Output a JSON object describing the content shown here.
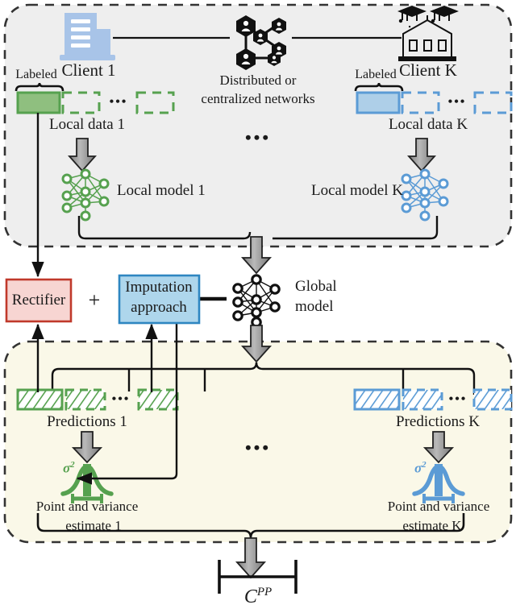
{
  "diagram": {
    "title_symbol": "C",
    "colors": {
      "client_zone_fill": "#eeeeee",
      "estimate_zone_fill": "#faf8e8",
      "green": "#56a14f",
      "green_fill": "#8fbf7f",
      "blue": "#5b9bd5",
      "blue_fill": "#aecfe8",
      "rect_red_border": "#c0392b",
      "rect_red_fill": "#f7d5d2",
      "imput_blue_border": "#2e86c1",
      "imput_blue_fill": "#aed6ec",
      "arrow_grey": "#9d9d9d",
      "line_black": "#111111"
    }
  },
  "client_zone": {
    "client1": {
      "label": "Client 1",
      "icon": "office-building-icon"
    },
    "clientK": {
      "label": "Client K",
      "icon": "university-building-icon"
    },
    "network": {
      "icon": "distributed-network-icon",
      "label_line1": "Distributed or",
      "label_line2": "centralized networks"
    },
    "ellipsis_center": "•••",
    "data1": {
      "labeled_tag": "Labeled",
      "label": "Local data 1",
      "ellipsis": "•••"
    },
    "dataK": {
      "labeled_tag": "Labeled",
      "label": "Local data K",
      "ellipsis": "•••"
    },
    "model1": {
      "label": "Local model 1",
      "icon": "neural-network-icon"
    },
    "modelK": {
      "label": "Local model K",
      "icon": "neural-network-icon"
    }
  },
  "middle": {
    "rectifier": {
      "label": "Rectifier"
    },
    "plus": "+",
    "imputation": {
      "line1": "Imputation",
      "line2": "approach"
    },
    "global_model": {
      "line1": "Global",
      "line2": "model",
      "icon": "neural-network-icon"
    }
  },
  "estimate_zone": {
    "predictions1": {
      "label": "Predictions 1",
      "ellipsis": "•••"
    },
    "predictionsK": {
      "label": "Predictions K",
      "ellipsis": "•••"
    },
    "ellipsis_center": "•••",
    "estimate1": {
      "line1": "Point and variance",
      "line2": "estimate 1",
      "icon": "gaussian-distribution-icon",
      "sigma": "σ",
      "sigma_exp": "2"
    },
    "estimateK": {
      "line1": "Point and variance",
      "line2": "estimate K",
      "icon": "gaussian-distribution-icon",
      "sigma": "σ",
      "sigma_exp": "2"
    }
  },
  "output": {
    "symbol_base": "C",
    "symbol_exp": "PP"
  }
}
